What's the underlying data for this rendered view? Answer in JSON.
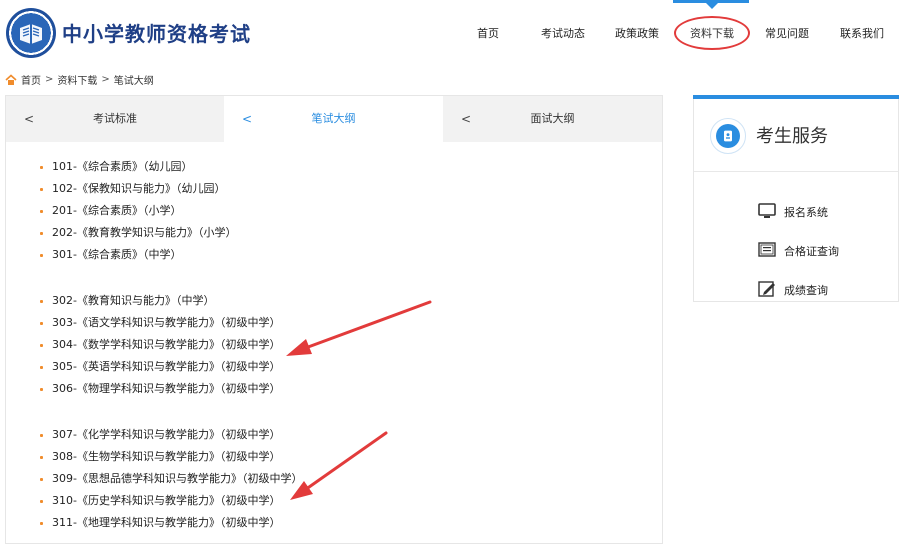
{
  "header": {
    "site_title": "中小学教师资格考试",
    "nav": [
      {
        "label": "首页"
      },
      {
        "label": "考试动态"
      },
      {
        "label": "政策政策"
      },
      {
        "label": "资料下载"
      },
      {
        "label": "常见问题"
      },
      {
        "label": "联系我们"
      }
    ],
    "active_nav": "资料下载"
  },
  "breadcrumb": {
    "items": [
      "首页",
      "资料下载",
      "笔试大纲"
    ],
    "separator": ">"
  },
  "tabs": [
    {
      "label": "考试标准"
    },
    {
      "label": "笔试大纲"
    },
    {
      "label": "面试大纲"
    }
  ],
  "exam_list": {
    "groups": [
      {
        "items": [
          "101-《综合素质》（幼儿园）",
          "102-《保教知识与能力》（幼儿园）",
          "201-《综合素质》（小学）",
          "202-《教育教学知识与能力》（小学）",
          "301-《综合素质》（中学）"
        ]
      },
      {
        "items": [
          "302-《教育知识与能力》（中学）",
          "303-《语文学科知识与教学能力》（初级中学）",
          "304-《数学学科知识与教学能力》（初级中学）",
          "305-《英语学科知识与教学能力》（初级中学）",
          "306-《物理学科知识与教学能力》（初级中学）"
        ]
      },
      {
        "items": [
          "307-《化学学科知识与教学能力》（初级中学）",
          "308-《生物学科知识与教学能力》（初级中学）",
          "309-《思想品德学科知识与教学能力》（初级中学）",
          "310-《历史学科知识与教学能力》（初级中学）",
          "311-《地理学科知识与教学能力》（初级中学）"
        ]
      }
    ]
  },
  "service_panel": {
    "title": "考生服务",
    "items": [
      {
        "label": "报名系统",
        "icon": "monitor-icon"
      },
      {
        "label": "合格证查询",
        "icon": "certificate-icon"
      },
      {
        "label": "成绩查询",
        "icon": "edit-icon"
      }
    ]
  },
  "colors": {
    "accent": "#2a8de0",
    "title": "#1f3f86",
    "annotation": "#e23b3b",
    "bullet": "#f08c2c"
  }
}
